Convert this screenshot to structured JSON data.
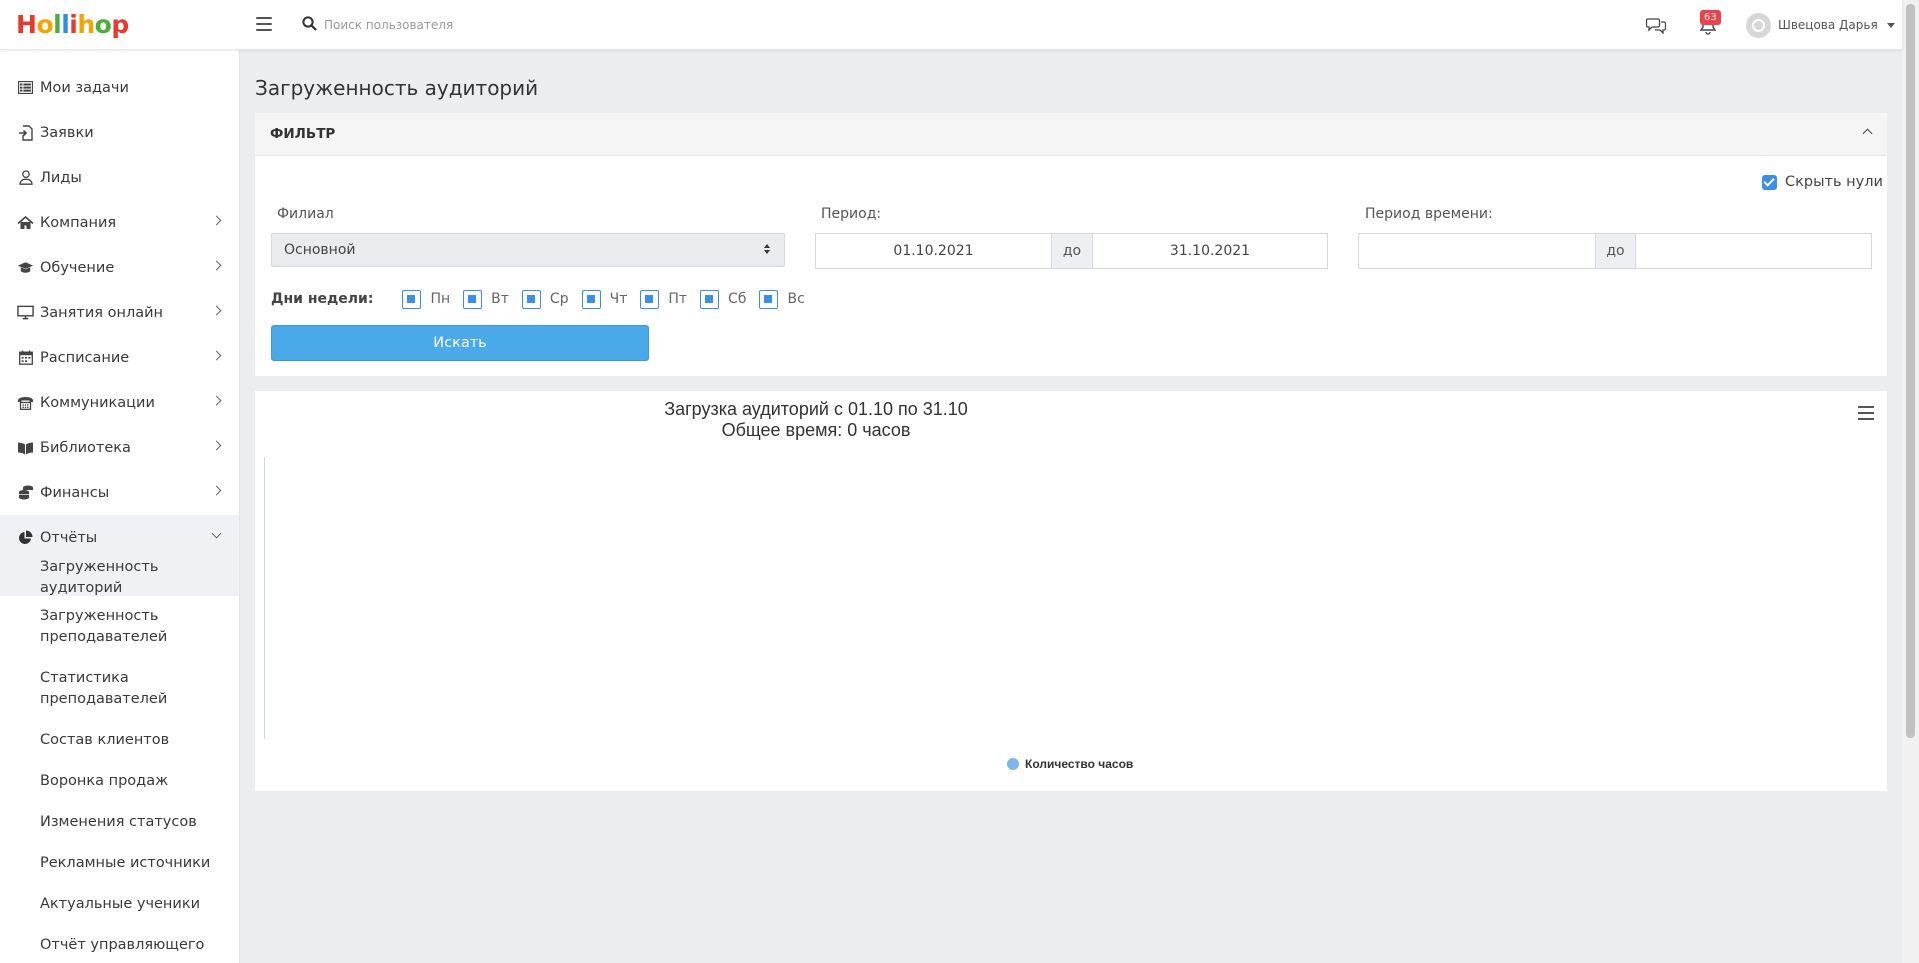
{
  "app": {
    "logo_letters": [
      {
        "ch": "H",
        "color": "#e8392c"
      },
      {
        "ch": "o",
        "color": "#f5a300"
      },
      {
        "ch": "l",
        "color": "#4cae3a"
      },
      {
        "ch": "l",
        "color": "#2f8ee0"
      },
      {
        "ch": "i",
        "color": "#e8392c"
      },
      {
        "ch": "h",
        "color": "#f5a300"
      },
      {
        "ch": "o",
        "color": "#4cae3a"
      },
      {
        "ch": "p",
        "color": "#e8392c"
      }
    ]
  },
  "topbar": {
    "search_placeholder": "Поиск пользователя",
    "notifications_count": "63",
    "user_name": "Швецова Дарья"
  },
  "sidebar": {
    "items": [
      {
        "label": "Мои задачи",
        "icon": "list-icon",
        "has_children": false
      },
      {
        "label": "Заявки",
        "icon": "file-import-icon",
        "has_children": false
      },
      {
        "label": "Лиды",
        "icon": "user-icon",
        "has_children": false
      },
      {
        "label": "Компания",
        "icon": "home-icon",
        "has_children": true
      },
      {
        "label": "Обучение",
        "icon": "graduation-cap-icon",
        "has_children": true
      },
      {
        "label": "Занятия онлайн",
        "icon": "monitor-icon",
        "has_children": true
      },
      {
        "label": "Расписание",
        "icon": "calendar-icon",
        "has_children": true
      },
      {
        "label": "Коммуникации",
        "icon": "phone-icon",
        "has_children": true
      },
      {
        "label": "Библиотека",
        "icon": "book-icon",
        "has_children": true
      },
      {
        "label": "Финансы",
        "icon": "coins-icon",
        "has_children": true
      },
      {
        "label": "Отчёты",
        "icon": "pie-chart-icon",
        "has_children": true,
        "open": true
      }
    ],
    "reports_sub": [
      {
        "label": "Загруженность аудиторий",
        "active": true
      },
      {
        "label": "Загруженность\nпреподавателей"
      },
      {
        "label": "Статистика\nпреподавателей"
      },
      {
        "label": "Состав клиентов"
      },
      {
        "label": "Воронка продаж"
      },
      {
        "label": "Изменения статусов"
      },
      {
        "label": "Рекламные источники"
      },
      {
        "label": "Актуальные ученики"
      },
      {
        "label": "Отчёт управляющего"
      }
    ]
  },
  "page": {
    "title": "Загруженность аудиторий"
  },
  "filter": {
    "title": "ФИЛЬТР",
    "hide_zero_label": "Скрыть нули",
    "hide_zero_checked": true,
    "branch_label": "Филиал",
    "branch_value": "Основной",
    "period_label": "Период:",
    "period_from": "01.10.2021",
    "period_to_label": "до",
    "period_to": "31.10.2021",
    "time_period_label": "Период времени:",
    "time_from": "",
    "time_to_label": "до",
    "time_to": "",
    "weekdays_label": "Дни недели:",
    "weekdays": [
      "Пн",
      "Вт",
      "Ср",
      "Чт",
      "Пт",
      "Сб",
      "Вс"
    ],
    "search_button": "Искать"
  },
  "chart_data": {
    "type": "bar",
    "title": "Загрузка аудиторий с 01.10 по 31.10",
    "subtitle": "Общее время: 0 часов",
    "categories": [],
    "series": [
      {
        "name": "Количество часов",
        "values": [],
        "color": "#7cb5ec"
      }
    ],
    "legend": "bottom-center"
  }
}
